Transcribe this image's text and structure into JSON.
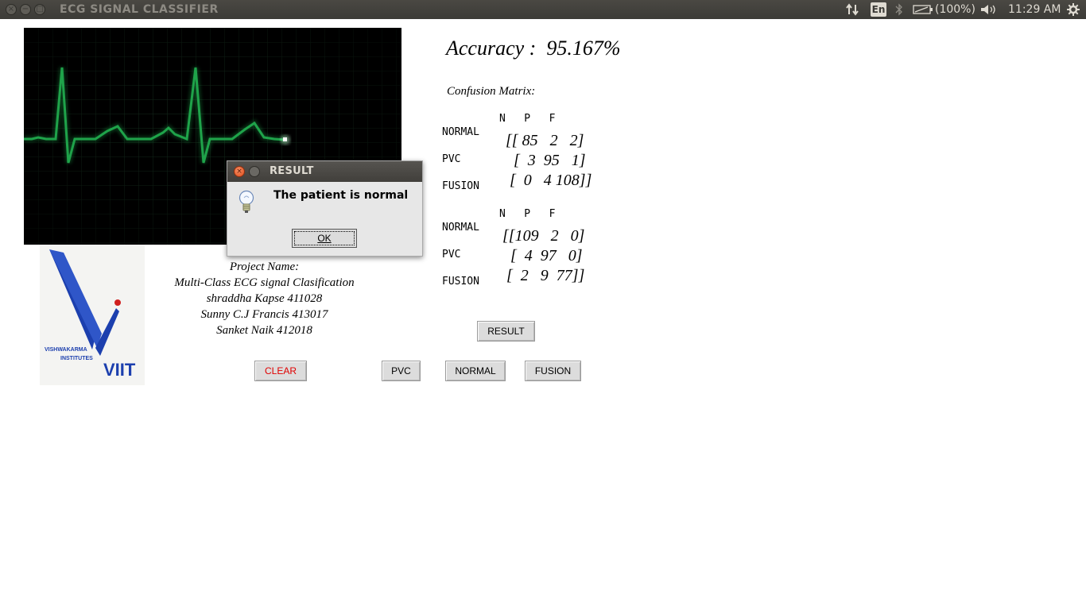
{
  "topbar": {
    "app_title": "ECG SIGNAL CLASSIFIER",
    "keyboard_layout": "En",
    "battery": "(100%)",
    "time": "11:29 AM"
  },
  "accuracy": {
    "text": "Accuracy :  95.167%"
  },
  "confusion": {
    "title": "Confusion Matrix:",
    "matrices": [
      {
        "header": "N   P   F",
        "labels": [
          "NORMAL",
          "PVC",
          "FUSION"
        ],
        "rows": [
          "[[ 85   2   2]",
          "  [  3  95   1]",
          " [  0   4 108]]"
        ]
      },
      {
        "header": "N   P   F",
        "labels": [
          "NORMAL",
          "PVC",
          "FUSION"
        ],
        "rows": [
          "[[109   2   0]",
          "  [  4  97   0]",
          " [  2   9  77]]"
        ]
      }
    ]
  },
  "project": {
    "heading": "Project Name:",
    "name": "Multi-Class ECG signal Clasification",
    "members": [
      "shraddha Kapse 411028",
      "Sunny C.J Francis 413017",
      "Sanket Naik 412018"
    ]
  },
  "logo": {
    "text_small_1": "VISHWAKARMA",
    "text_small_2": "INSTITUTES",
    "text_big": "VIIT"
  },
  "buttons": {
    "result": "RESULT",
    "clear": "CLEAR",
    "pvc": "PVC",
    "normal": "NORMAL",
    "fusion": "FUSION"
  },
  "dialog": {
    "title": "RESULT",
    "message": "The patient is normal",
    "ok": "OK"
  },
  "colors": {
    "ecg_trace": "#1fa34a",
    "clear_text": "#e00000",
    "logo_blue": "#1c3fae"
  }
}
